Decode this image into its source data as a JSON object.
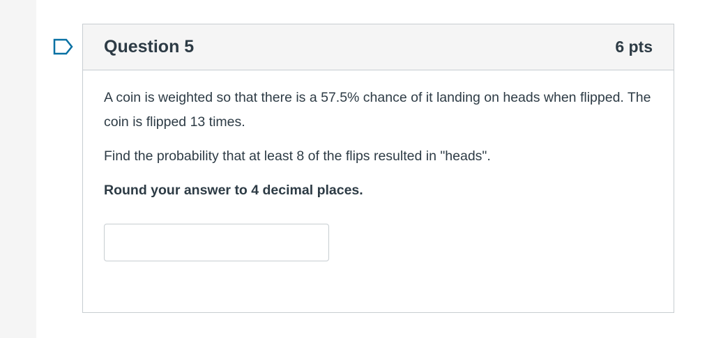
{
  "question": {
    "title": "Question 5",
    "points": "6 pts",
    "paragraph1": "A coin is weighted so that there is a 57.5% chance of it landing on heads when flipped. The coin is flipped 13 times.",
    "paragraph2": "Find the probability that at least 8 of the flips resulted in \"heads\".",
    "instruction": "Round your answer to 4 decimal places.",
    "answer_value": ""
  },
  "flag": {
    "icon": "flag-outline-icon",
    "color": "#0770a3"
  },
  "colors": {
    "text": "#2d3b45",
    "header_bg": "#f5f5f5",
    "border": "#c7cdd1",
    "accent": "#0770a3"
  }
}
